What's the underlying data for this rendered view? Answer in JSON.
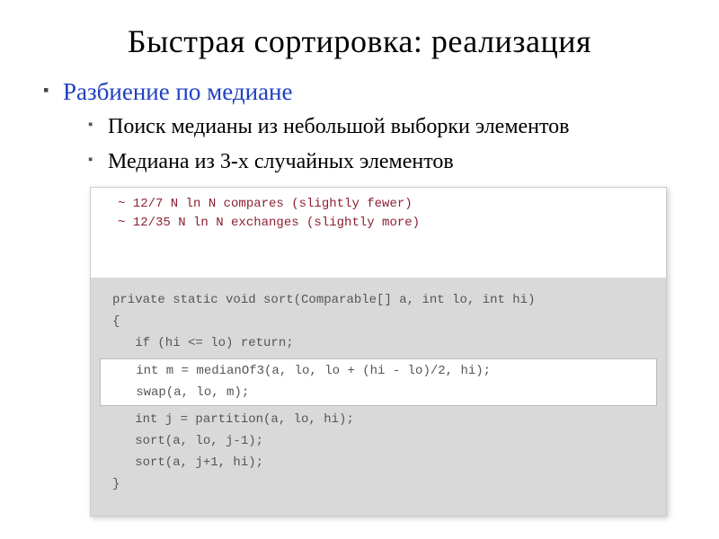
{
  "title": "Быстрая сортировка: реализация",
  "bullet1": "Разбиение по медиане",
  "bullet1_1": "Поиск медианы из небольшой выборки элементов",
  "bullet1_2": "Медиана из 3-х случайных элементов",
  "note1": "~  12/7   N ln N compares (slightly fewer)",
  "note2": "~  12/35 N ln N exchanges (slightly more)",
  "code": {
    "l1": "private static void sort(Comparable[] a, int lo, int hi)",
    "l2": "{",
    "l3": "   if (hi <= lo) return;",
    "l4": "",
    "l5": "   int m = medianOf3(a, lo, lo + (hi - lo)/2, hi);",
    "l6": "   swap(a, lo, m);",
    "l7": "",
    "l8": "   int j = partition(a, lo, hi);",
    "l9": "   sort(a, lo, j-1);",
    "l10": "   sort(a, j+1, hi);",
    "l11": "}"
  }
}
